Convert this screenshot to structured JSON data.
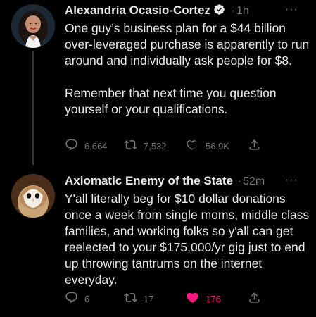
{
  "tweets": [
    {
      "author": "Alexandria Ocasio-Cortez",
      "separator": "·",
      "time": "1h",
      "more": "···",
      "text": "One guy’s business plan for a $44 billion over-leveraged purchase is apparently to run around and individually ask people for $8.\n\nRemember that next time you question yourself or your qualifications.",
      "replies": "6,664",
      "retweets": "7,532",
      "likes": "56.9K",
      "verified": true
    },
    {
      "author": "Axiomatic Enemy of the State",
      "separator": "·",
      "time": "52m",
      "more": "···",
      "text": "Y'all literally beg for $10 dollar donations once a week from single moms, middle class families, and working folks so y'all can get reelected to your $175,000/yr gig just to end up throwing tantrums on the internet everyday.",
      "replies": "6",
      "retweets": "17",
      "likes": "176",
      "liked": true,
      "like_color": "#f91880"
    }
  ],
  "icons": {
    "reply": "reply-icon",
    "retweet": "retweet-icon",
    "like": "heart-icon",
    "share": "share-icon",
    "verified": "verified-badge-icon"
  },
  "colors": {
    "background": "#000000",
    "text": "#e7e9ea",
    "muted": "#71767b",
    "like_active": "#f91880"
  }
}
